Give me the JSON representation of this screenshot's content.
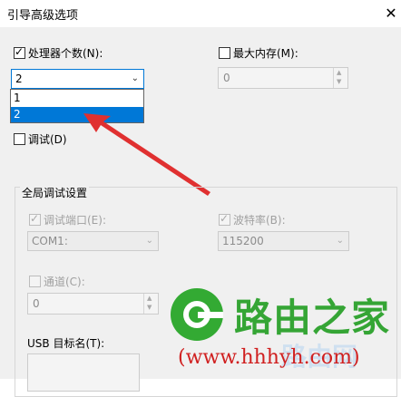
{
  "window": {
    "title": "引导高级选项",
    "close_glyph": "✕"
  },
  "processors": {
    "label": "处理器个数(N):",
    "checked": true,
    "value": "2",
    "options": [
      "1",
      "2"
    ],
    "selected_option": "2"
  },
  "max_memory": {
    "label": "最大内存(M):",
    "checked": false,
    "value": "0"
  },
  "debug": {
    "label": "调试(D)",
    "checked": false
  },
  "global_debug": {
    "title": "全局调试设置",
    "debug_port": {
      "label": "调试端口(E):",
      "checked": true,
      "value": "COM1:"
    },
    "baud_rate": {
      "label": "波特率(B):",
      "checked": true,
      "value": "115200"
    },
    "channel": {
      "label": "通道(C):",
      "checked": false,
      "value": "0"
    },
    "usb_target": {
      "label": "USB 目标名(T):"
    }
  },
  "watermark": {
    "site_name": "路由之家",
    "url": "(www.hhhyh.com)",
    "faint_text": "路由网"
  },
  "colors": {
    "selection": "#0078d7",
    "annotation_arrow": "#e03030",
    "watermark_green": "#35a535",
    "watermark_red": "#d02020"
  }
}
